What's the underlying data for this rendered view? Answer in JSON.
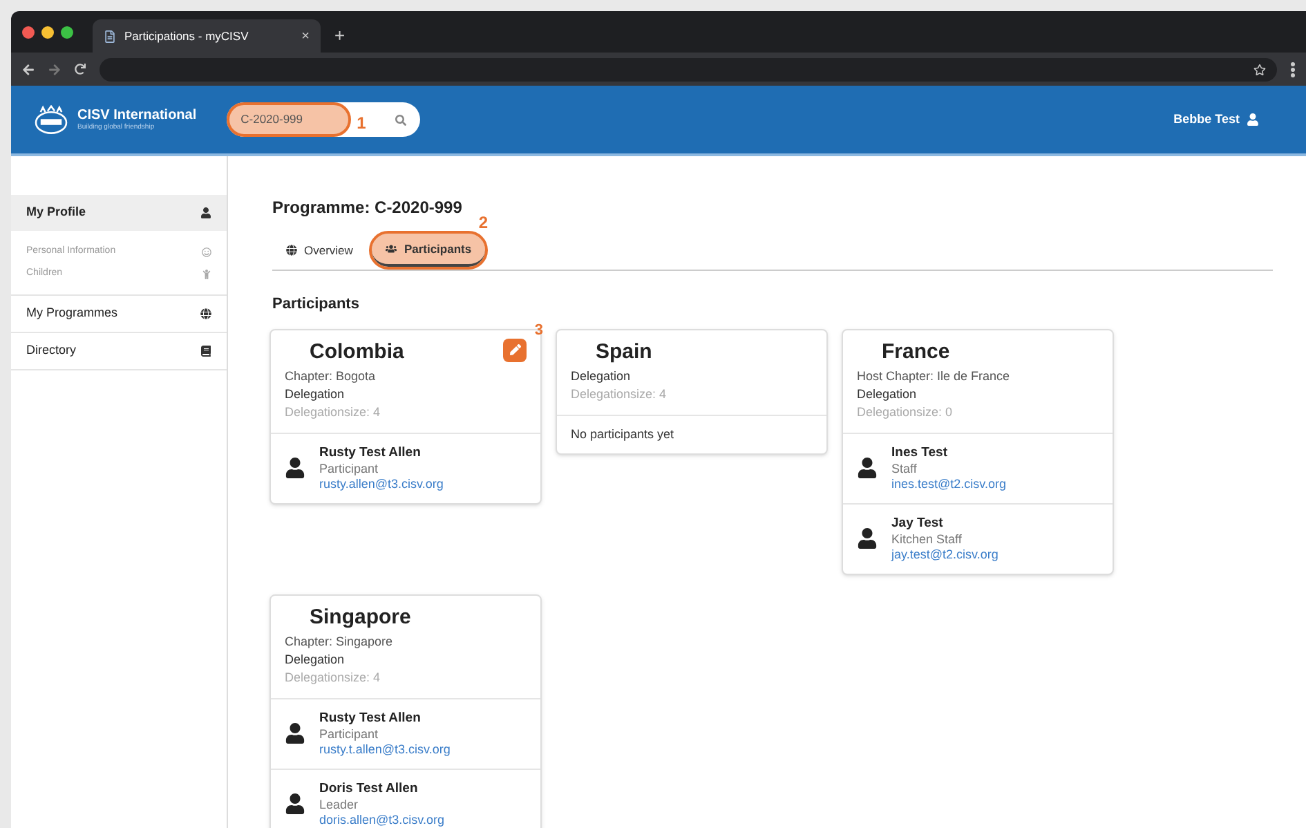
{
  "browser": {
    "tab_title": "Participations - myCISV",
    "tab_close": "×",
    "new_tab": "+"
  },
  "header": {
    "brand": "CISV International",
    "tagline": "Building global friendship",
    "search": {
      "value": "C-2020-999",
      "annotation": "1"
    },
    "user": "Bebbe Test"
  },
  "sidebar": {
    "items": [
      {
        "label": "My Profile",
        "kind": "user",
        "selected": true,
        "children": [
          {
            "label": "Personal Information",
            "kind": "circle"
          },
          {
            "label": "Children",
            "kind": "child"
          }
        ]
      },
      {
        "label": "My Programmes",
        "kind": "globe",
        "selected": false
      },
      {
        "label": "Directory",
        "kind": "book",
        "selected": false
      }
    ]
  },
  "programme_title": "Programme: C-2020-999",
  "tabs": [
    {
      "label": "Overview",
      "kind": "globe",
      "selected": false
    },
    {
      "label": "Participants",
      "kind": "users",
      "selected": true,
      "annotation": "2"
    }
  ],
  "section_title": "Participants",
  "cards": [
    {
      "country": "Colombia",
      "edit_annotation": "3",
      "lines": [
        {
          "kind": "chapter",
          "text": "Chapter: Bogota"
        },
        {
          "kind": "type",
          "text": "Delegation"
        },
        {
          "kind": "size",
          "text": "Delegationsize: 4"
        }
      ],
      "people": [
        {
          "name": "Rusty Test Allen",
          "role": "Participant",
          "email": "rusty.allen@t3.cisv.org"
        }
      ]
    },
    {
      "country": "Spain",
      "lines": [
        {
          "kind": "type",
          "text": "Delegation"
        },
        {
          "kind": "size",
          "text": "Delegationsize: 4"
        }
      ],
      "empty_text": "No participants yet"
    },
    {
      "country": "France",
      "lines": [
        {
          "kind": "chapter",
          "text": "Host Chapter: Ile de France"
        },
        {
          "kind": "type",
          "text": "Delegation"
        },
        {
          "kind": "size",
          "text": "Delegationsize: 0"
        }
      ],
      "people": [
        {
          "name": "Ines Test",
          "role": "Staff",
          "email": "ines.test@t2.cisv.org"
        },
        {
          "name": "Jay Test",
          "role": "Kitchen Staff",
          "email": "jay.test@t2.cisv.org"
        }
      ]
    },
    {
      "country": "Singapore",
      "lines": [
        {
          "kind": "chapter",
          "text": "Chapter: Singapore"
        },
        {
          "kind": "type",
          "text": "Delegation"
        },
        {
          "kind": "size",
          "text": "Delegationsize: 4"
        }
      ],
      "people": [
        {
          "name": "Rusty Test Allen",
          "role": "Participant",
          "email": "rusty.t.allen@t3.cisv.org"
        },
        {
          "name": "Doris Test Allen",
          "role": "Leader",
          "email": "doris.allen@t3.cisv.org"
        }
      ]
    }
  ]
}
